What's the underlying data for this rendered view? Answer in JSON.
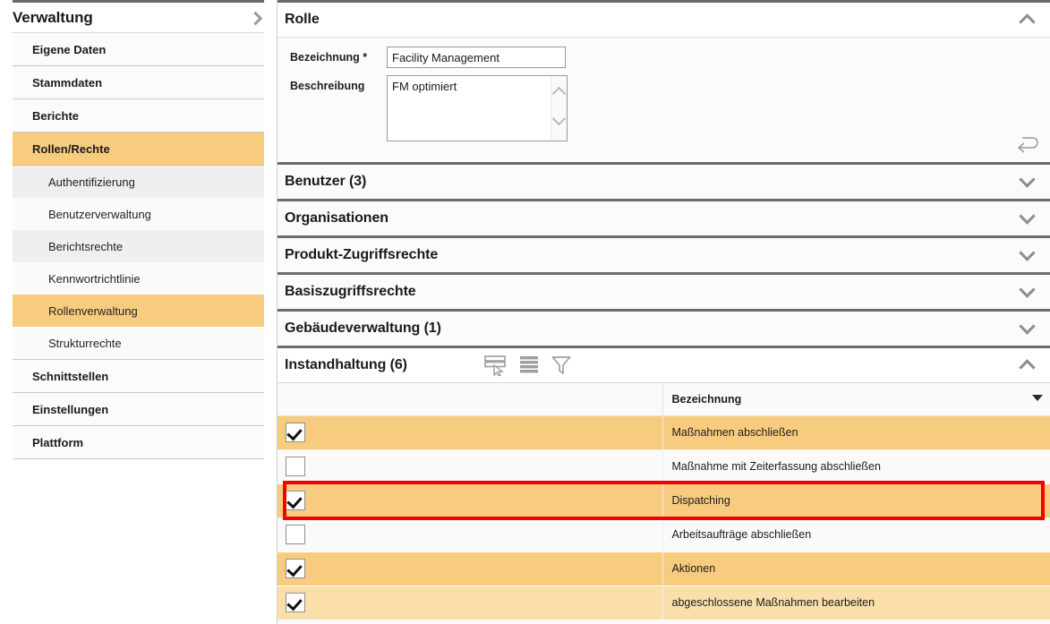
{
  "sidebar": {
    "title": "Verwaltung",
    "expand_icon": "chevron-right-icon",
    "items": [
      {
        "label": "Eigene Daten",
        "level": "top",
        "selected": false
      },
      {
        "label": "Stammdaten",
        "level": "top",
        "selected": false
      },
      {
        "label": "Berichte",
        "level": "top",
        "selected": false
      },
      {
        "label": "Rollen/Rechte",
        "level": "top",
        "selected": true
      },
      {
        "label": "Authentifizierung",
        "level": "sub",
        "selected": false
      },
      {
        "label": "Benutzerverwaltung",
        "level": "sub",
        "selected": false
      },
      {
        "label": "Berichtsrechte",
        "level": "sub",
        "selected": false
      },
      {
        "label": "Kennwortrichtlinie",
        "level": "sub",
        "selected": false
      },
      {
        "label": "Rollenverwaltung",
        "level": "sub",
        "selected": true
      },
      {
        "label": "Strukturrechte",
        "level": "sub",
        "selected": false
      },
      {
        "label": "Schnittstellen",
        "level": "top",
        "selected": false
      },
      {
        "label": "Einstellungen",
        "level": "top",
        "selected": false
      },
      {
        "label": "Plattform",
        "level": "top",
        "selected": false
      }
    ]
  },
  "role_panel": {
    "title": "Rolle",
    "collapse_icon": "chevron-up-icon",
    "fields": {
      "bezeichnung_label": "Bezeichnung *",
      "bezeichnung_value": "Facility Management",
      "bezeichnung_placeholder": "",
      "beschreibung_label": "Beschreibung",
      "beschreibung_value": "FM optimiert",
      "beschreibung_placeholder": ""
    },
    "undo_icon": "undo-arrow-icon"
  },
  "sections": [
    {
      "title": "Benutzer (3)",
      "state": "collapsed",
      "icon": "chevron-down-icon"
    },
    {
      "title": "Organisationen",
      "state": "collapsed",
      "icon": "chevron-down-icon"
    },
    {
      "title": "Produkt-Zugriffsrechte",
      "state": "collapsed",
      "icon": "chevron-down-icon"
    },
    {
      "title": "Basiszugriffsrechte",
      "state": "collapsed",
      "icon": "chevron-down-icon"
    },
    {
      "title": "Gebäudeverwaltung (1)",
      "state": "collapsed",
      "icon": "chevron-down-icon"
    }
  ],
  "maintenance": {
    "title": "Instandhaltung (6)",
    "collapse_icon": "chevron-up-icon",
    "toolbar": [
      {
        "name": "column-chooser-icon",
        "title": "Spaltenauswahl"
      },
      {
        "name": "row-density-icon",
        "title": "Zeilenhöhe"
      },
      {
        "name": "filter-funnel-icon",
        "title": "Filter"
      }
    ],
    "table": {
      "columns": [
        "",
        "Bezeichnung"
      ],
      "sort_icon": "sort-caret-down-icon",
      "rows": [
        {
          "checked": true,
          "label": "Maßnahmen abschließen",
          "highlight": "on",
          "annotated": false
        },
        {
          "checked": false,
          "label": "Maßnahme mit Zeiterfassung abschließen",
          "highlight": "off",
          "annotated": false
        },
        {
          "checked": true,
          "label": "Dispatching",
          "highlight": "on",
          "annotated": true
        },
        {
          "checked": false,
          "label": "Arbeitsaufträge abschließen",
          "highlight": "off",
          "annotated": false
        },
        {
          "checked": true,
          "label": "Aktionen",
          "highlight": "on",
          "annotated": false
        },
        {
          "checked": true,
          "label": "abgeschlossene Maßnahmen bearbeiten",
          "highlight": "on2",
          "annotated": false
        }
      ]
    }
  },
  "colors": {
    "selection_orange": "#f8cc7f",
    "selection_orange_light": "#fadfab",
    "annotation_red": "#f40000",
    "rule_dark": "#6b6b6b"
  }
}
